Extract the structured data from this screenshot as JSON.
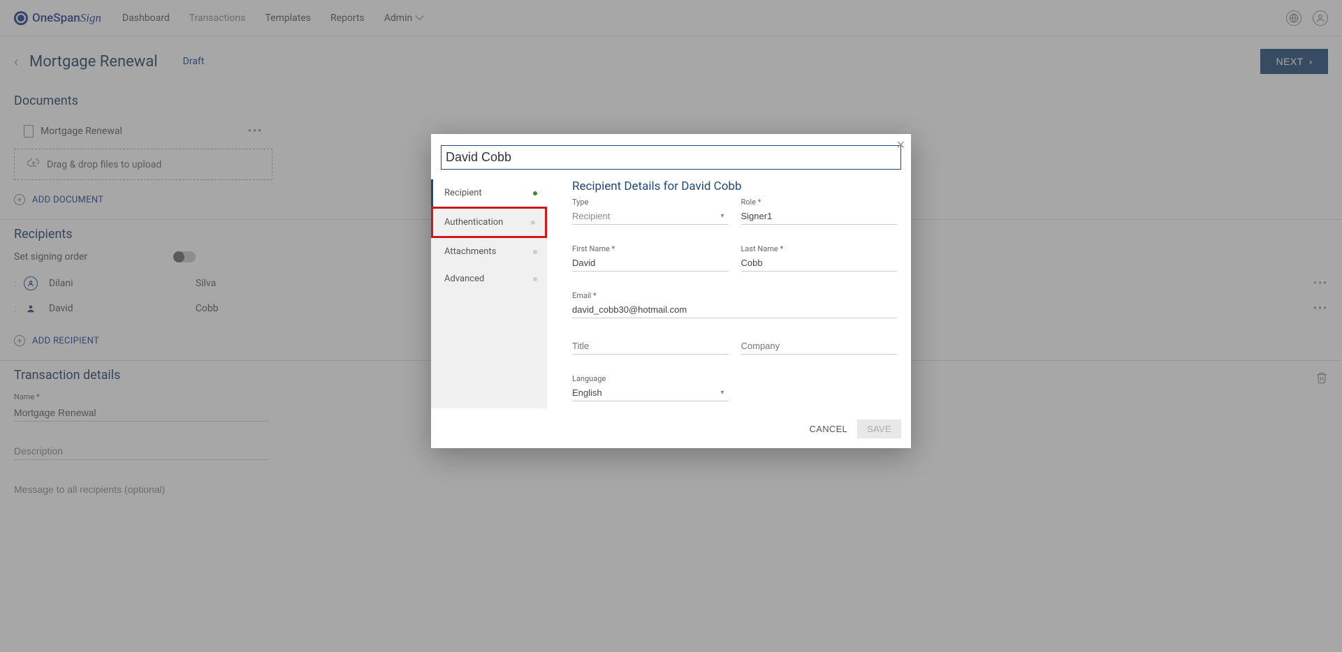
{
  "header": {
    "logo_text": "OneSpan",
    "logo_script": "Sign",
    "nav": {
      "dashboard": "Dashboard",
      "transactions": "Transactions",
      "templates": "Templates",
      "reports": "Reports",
      "admin": "Admin"
    }
  },
  "page": {
    "title": "Mortgage Renewal",
    "status": "Draft",
    "next_label": "NEXT"
  },
  "documents": {
    "heading": "Documents",
    "items": [
      {
        "name": "Mortgage Renewal"
      }
    ],
    "dragdrop_text": "Drag & drop files to upload",
    "add_label": "ADD DOCUMENT"
  },
  "recipients": {
    "heading": "Recipients",
    "signing_order_label": "Set signing order",
    "items": [
      {
        "first": "Dilani",
        "last": "Silva",
        "type": "sender"
      },
      {
        "first": "David",
        "last": "Cobb",
        "type": "signer"
      }
    ],
    "add_label": "ADD RECIPIENT"
  },
  "transaction": {
    "heading": "Transaction details",
    "name_label": "Name *",
    "name_value": "Mortgage Renewal",
    "description_placeholder": "Description",
    "message_placeholder": "Message to all recipients (optional)"
  },
  "modal": {
    "recipient_name": "David Cobb",
    "tabs": {
      "recipient": "Recipient",
      "authentication": "Authentication",
      "attachments": "Attachments",
      "advanced": "Advanced"
    },
    "content_title": "Recipient Details for David Cobb",
    "fields": {
      "type_label": "Type",
      "type_value": "Recipient",
      "role_label": "Role *",
      "role_value": "Signer1",
      "first_name_label": "First Name *",
      "first_name_value": "David",
      "last_name_label": "Last Name *",
      "last_name_value": "Cobb",
      "email_label": "Email *",
      "email_value": "david_cobb30@hotmail.com",
      "title_label": "Title",
      "title_value": "",
      "company_label": "Company",
      "company_value": "",
      "language_label": "Language",
      "language_value": "English"
    },
    "actions": {
      "cancel": "CANCEL",
      "save": "SAVE"
    }
  }
}
